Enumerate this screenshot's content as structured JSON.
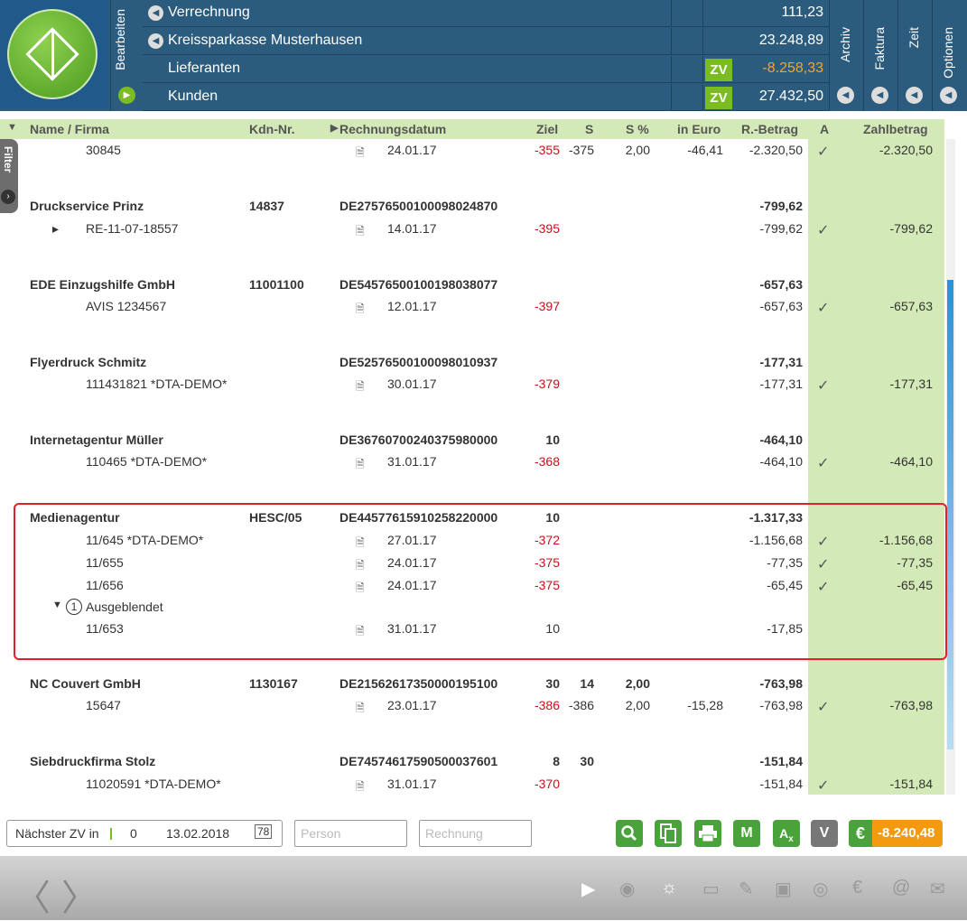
{
  "header": {
    "bearbeiten": "Bearbeiten",
    "rows": [
      {
        "label": "Verrechnung",
        "zv": "",
        "value": "111,23",
        "value_color": "normal"
      },
      {
        "label": "Kreissparkasse Musterhausen",
        "zv": "",
        "value": "23.248,89",
        "value_color": "normal"
      },
      {
        "label": "Lieferanten",
        "zv": "ZV",
        "value": "-8.258,33",
        "value_color": "orange"
      },
      {
        "label": "Kunden",
        "zv": "ZV",
        "value": "27.432,50",
        "value_color": "normal"
      }
    ],
    "tabs": [
      "Archiv",
      "Faktura",
      "Zeit",
      "Optionen"
    ]
  },
  "filter_label": "Filter",
  "columns": {
    "name": "Name / Firma",
    "kdn": "Kdn-Nr.",
    "datum": "Rechnungsdatum",
    "ziel": "Ziel",
    "s": "S",
    "sproz": "S %",
    "ineuro": "in Euro",
    "rbetrag": "R.-Betrag",
    "a": "A",
    "zahlbetrag": "Zahlbetrag"
  },
  "rows": [
    {
      "type": "sub",
      "name": "30845",
      "date": "24.01.17",
      "ziel": "-355",
      "s": "-375",
      "sp": "2,00",
      "eur": "-46,41",
      "rb": "-2.320,50",
      "check": "✓",
      "zb": "-2.320,50"
    },
    {
      "type": "group",
      "name": "Druckservice Prinz",
      "kdn": "14837",
      "iban": "DE27576500100098024870",
      "ziel": "",
      "s": "",
      "sp": "",
      "rb": "-799,62"
    },
    {
      "type": "sub",
      "arrow": "▸",
      "name": "RE-11-07-18557",
      "date": "14.01.17",
      "ziel": "-395",
      "s": "",
      "sp": "",
      "eur": "",
      "rb": "-799,62",
      "check": "✓",
      "zb": "-799,62"
    },
    {
      "type": "group",
      "name": "EDE Einzugshilfe GmbH",
      "kdn": "11001100",
      "iban": "DE54576500100198038077",
      "ziel": "",
      "s": "",
      "sp": "",
      "rb": "-657,63"
    },
    {
      "type": "sub",
      "name": "AVIS 1234567",
      "date": "12.01.17",
      "ziel": "-397",
      "s": "",
      "sp": "",
      "eur": "",
      "rb": "-657,63",
      "check": "✓",
      "zb": "-657,63"
    },
    {
      "type": "group",
      "name": "Flyerdruck Schmitz",
      "kdn": "",
      "iban": "DE52576500100098010937",
      "ziel": "",
      "s": "",
      "sp": "",
      "rb": "-177,31"
    },
    {
      "type": "sub",
      "name": "111431821 *DTA-DEMO*",
      "date": "30.01.17",
      "ziel": "-379",
      "s": "",
      "sp": "",
      "eur": "",
      "rb": "-177,31",
      "check": "✓",
      "zb": "-177,31"
    },
    {
      "type": "group",
      "name": "Internetagentur Müller",
      "kdn": "",
      "iban": "DE36760700240375980000",
      "ziel": "10",
      "s": "",
      "sp": "",
      "rb": "-464,10"
    },
    {
      "type": "sub",
      "name": "110465 *DTA-DEMO*",
      "date": "31.01.17",
      "ziel": "-368",
      "s": "",
      "sp": "",
      "eur": "",
      "rb": "-464,10",
      "check": "✓",
      "zb": "-464,10"
    },
    {
      "type": "group",
      "name": "Medienagentur",
      "kdn": "HESC/05",
      "iban": "DE44577615910258220000",
      "ziel": "10",
      "s": "",
      "sp": "",
      "rb": "-1.317,33"
    },
    {
      "type": "sub",
      "name": "11/645 *DTA-DEMO*",
      "date": "27.01.17",
      "ziel": "-372",
      "s": "",
      "sp": "",
      "eur": "",
      "rb": "-1.156,68",
      "check": "✓",
      "zb": "-1.156,68"
    },
    {
      "type": "sub",
      "name": "11/655",
      "date": "24.01.17",
      "ziel": "-375",
      "s": "",
      "sp": "",
      "eur": "",
      "rb": "-77,35",
      "check": "✓",
      "zb": "-77,35"
    },
    {
      "type": "sub",
      "name": "11/656",
      "date": "24.01.17",
      "ziel": "-375",
      "s": "",
      "sp": "",
      "eur": "",
      "rb": "-65,45",
      "check": "✓",
      "zb": "-65,45"
    },
    {
      "type": "hidden",
      "count": "1",
      "name": "Ausgeblendet"
    },
    {
      "type": "sub",
      "name": "11/653",
      "date": "31.01.17",
      "ziel": "10",
      "ziel_black": true,
      "s": "",
      "sp": "",
      "eur": "",
      "rb": "-17,85",
      "check": "",
      "zb": ""
    },
    {
      "type": "group",
      "name": "NC Couvert GmbH",
      "kdn": "1130167",
      "iban": "DE21562617350000195100",
      "ziel": "30",
      "s": "14",
      "sp": "2,00",
      "rb": "-763,98"
    },
    {
      "type": "sub",
      "name": "15647",
      "date": "23.01.17",
      "ziel": "-386",
      "s": "-386",
      "sp": "2,00",
      "eur": "-15,28",
      "rb": "-763,98",
      "check": "✓",
      "zb": "-763,98"
    },
    {
      "type": "group",
      "name": "Siebdruckfirma Stolz",
      "kdn": "",
      "iban": "DE74574617590500037601",
      "ziel": "8",
      "s": "30",
      "sp": "",
      "rb": "-151,84"
    },
    {
      "type": "sub",
      "name": "11020591 *DTA-DEMO*",
      "date": "31.01.17",
      "ziel": "-370",
      "s": "",
      "sp": "",
      "eur": "",
      "rb": "-151,84",
      "check": "✓",
      "zb": "-151,84"
    }
  ],
  "footer": {
    "next_zv_label": "Nächster ZV in",
    "next_zv_days": "0",
    "next_zv_date": "13.02.2018",
    "calendar_glyph": "78",
    "person_placeholder": "Person",
    "rechnung_placeholder": "Rechnung",
    "btn_m": "M",
    "btn_v": "V",
    "total": "-8.240,48",
    "euro_symbol": "€"
  }
}
